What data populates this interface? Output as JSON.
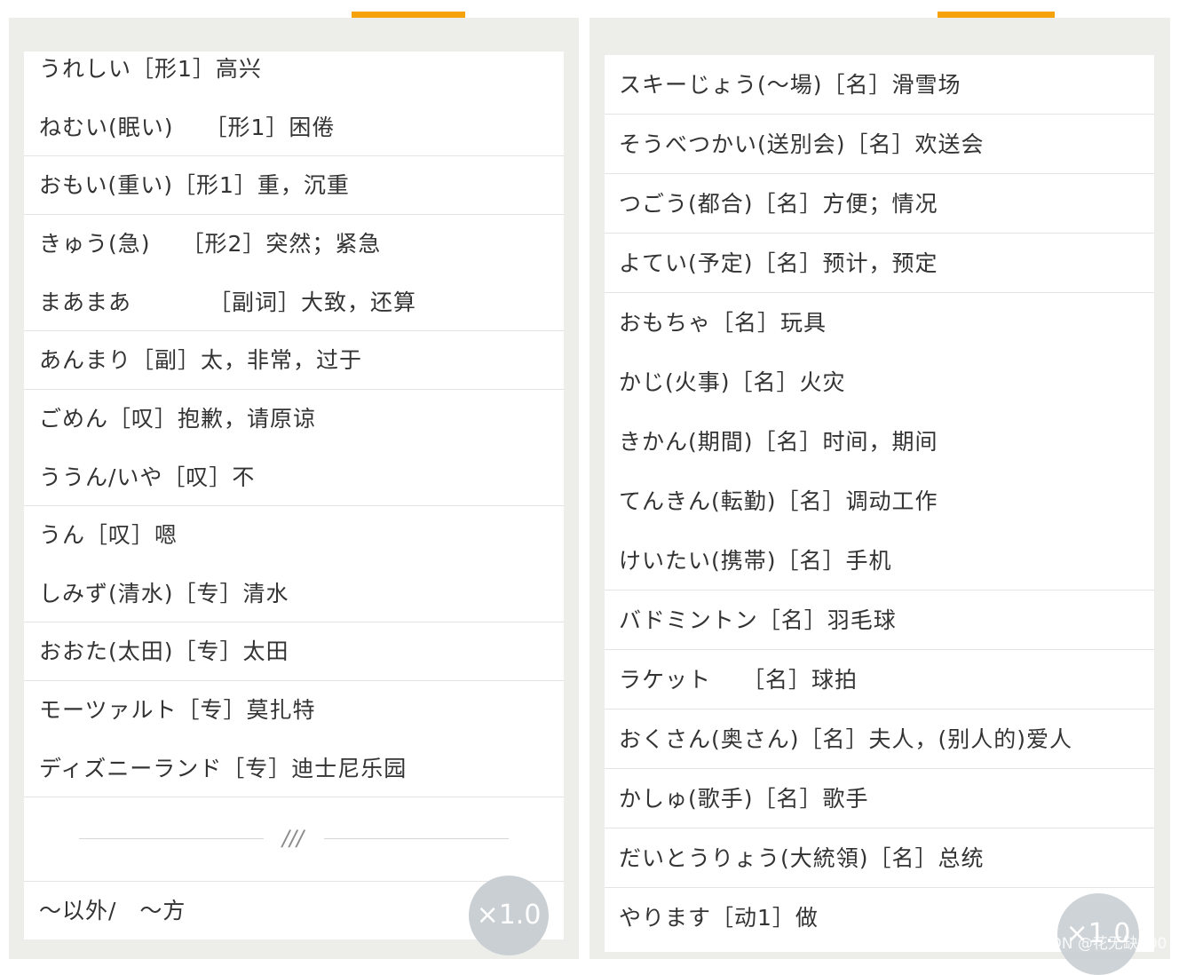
{
  "left": {
    "items": [
      "うれしい［形1］高兴",
      "ねむい(眠い)　 ［形1］困倦",
      "おもい(重い)［形1］重，沉重",
      "きゅう(急)　 ［形2］突然；紧急",
      "まあまあ　　　 ［副词］大致，还算",
      "あんまり［副］太，非常，过于",
      "ごめん［叹］抱歉，请原谅",
      "ううん/いや［叹］不",
      "うん［叹］嗯",
      "しみず(清水)［专］清水",
      "おおた(太田)［专］太田",
      "モーツァルト［专］莫扎特",
      "ディズニーランド［专］迪士尼乐园"
    ],
    "footer_text": "～以外/　～方",
    "speed_label": "×1.0",
    "divider_icon": "ornament-slash-icon"
  },
  "right": {
    "items": [
      "スキーじょう(～場)［名］滑雪场",
      "そうべつかい(送別会)［名］欢送会",
      "つごう(都合)［名］方便；情况",
      "よてい(予定)［名］预计，预定",
      "おもちゃ［名］玩具",
      "かじ(火事)［名］火灾",
      "きかん(期間)［名］时间，期间",
      "てんきん(転勤)［名］调动工作",
      "けいたい(携帯)［名］手机",
      "バドミントン［名］羽毛球",
      "ラケット　 ［名］球拍",
      "おくさん(奥さん)［名］夫人，(别人的)爱人",
      "かしゅ(歌手)［名］歌手",
      "だいとうりょう(大統領)［名］总统",
      "やります［动1］做"
    ],
    "speed_label": "×1.0"
  },
  "watermark": "CSDN @花无缺000",
  "colors": {
    "accent": "#f6a20c",
    "panel_bg": "#ededea",
    "text": "#333333",
    "speed_button": "#c9cfd3"
  }
}
